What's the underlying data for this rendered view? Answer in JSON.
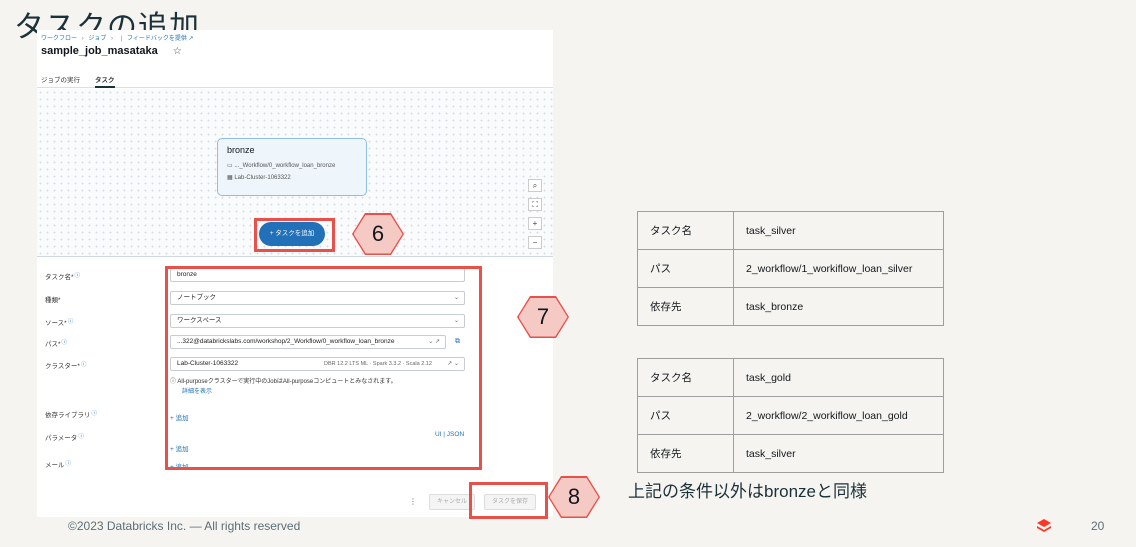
{
  "slide": {
    "title": "タスクの追加",
    "footer": "©2023 Databricks Inc. — All rights reserved",
    "page_number": "20",
    "summary": "上記の条件以外はbronzeと同様"
  },
  "screenshot": {
    "breadcrumb": [
      "ワークフロー",
      "ジョブ",
      "|",
      "フィードバックを提供"
    ],
    "job_title": "sample_job_masataka",
    "star": "☆",
    "tabs": [
      {
        "label": "ジョブの実行"
      },
      {
        "label": "タスク"
      }
    ],
    "node": {
      "name": "bronze",
      "path": "..._Workflow/0_workflow_loan_bronze",
      "cluster": "Lab-Cluster-1063322"
    },
    "zoom_controls": [
      "⌕",
      "⛶",
      "+",
      "−"
    ],
    "add_task_button": "+ タスクを追加",
    "form": {
      "task_name_label": "タスク名*",
      "task_name_value": "bronze",
      "type_label": "種類*",
      "type_value": "ノートブック",
      "source_label": "ソース*",
      "source_value": "ワークスペース",
      "path_label": "パス*",
      "path_value": "...322@databrickslabs.com/workshop/2_Workflow/0_workflow_loan_bronze",
      "cluster_label": "クラスター*",
      "cluster_value": "Lab-Cluster-1063322",
      "cluster_spec": "DBR 12.2 LTS ML · Spark 3.3.2 · Scala 2.12",
      "cluster_note": "All-purposeクラスターで実行中のJobはAll-purposeコンピュートとみなされます。",
      "cluster_note_link": "詳細を表示",
      "deps_label": "依存ライブラリ",
      "deps_add": "+ 追加",
      "params_label": "パラメータ",
      "params_toggle": "UI | JSON",
      "params_add": "+ 追加",
      "email_label": "メール",
      "email_add": "+ 追加"
    },
    "cancel_button": "キャンセル",
    "save_button": "タスクを保存"
  },
  "callouts": [
    "6",
    "7",
    "8"
  ],
  "tables": [
    {
      "rows": [
        {
          "key": "タスク名",
          "value": "task_silver"
        },
        {
          "key": "パス",
          "value": "2_workflow/1_workiflow_loan_silver"
        },
        {
          "key": "依存先",
          "value": "task_bronze"
        }
      ]
    },
    {
      "rows": [
        {
          "key": "タスク名",
          "value": "task_gold"
        },
        {
          "key": "パス",
          "value": "2_workflow/2_workiflow_loan_gold"
        },
        {
          "key": "依存先",
          "value": "task_silver"
        }
      ]
    }
  ],
  "colors": {
    "accent": "#2170b8",
    "callout_border": "#e8504a",
    "callout_fill": "#f5c9c4"
  }
}
